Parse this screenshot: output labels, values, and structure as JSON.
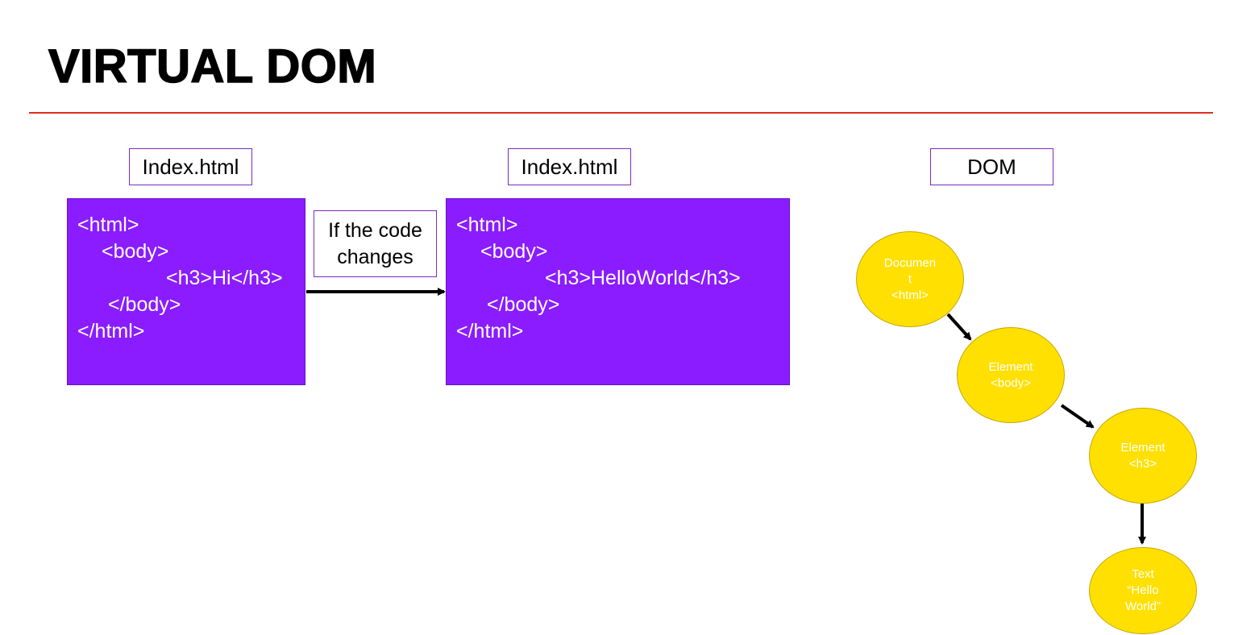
{
  "title": "VIRTUAL DOM",
  "colors": {
    "accent_rule": "#e0301e",
    "code_box_fill": "#8a1cff",
    "label_border": "#7b2cbf",
    "node_fill": "#ffe000"
  },
  "labels": {
    "left": "Index.html",
    "middle": "Index.html",
    "right": "DOM"
  },
  "code_before": {
    "line1": "<html>",
    "line2": "<body>",
    "line3": "<h3>Hi</h3>",
    "line4": "</body>",
    "line5": "</html>"
  },
  "code_after": {
    "line1": "<html>",
    "line2": "<body>",
    "line3": "<h3>HelloWorld</h3>",
    "line4": "</body>",
    "line5": "</html>"
  },
  "change_note": {
    "line1": "If the code",
    "line2": "changes"
  },
  "dom_tree": {
    "document": {
      "line1": "Documen",
      "line2": "t",
      "line3": "<html>"
    },
    "body": {
      "line1": "Element",
      "line2": "<body>"
    },
    "h3": {
      "line1": "Element",
      "line2": "<h3>"
    },
    "text": {
      "line1": "Text",
      "line2": "“Hello",
      "line3": "World”"
    }
  }
}
